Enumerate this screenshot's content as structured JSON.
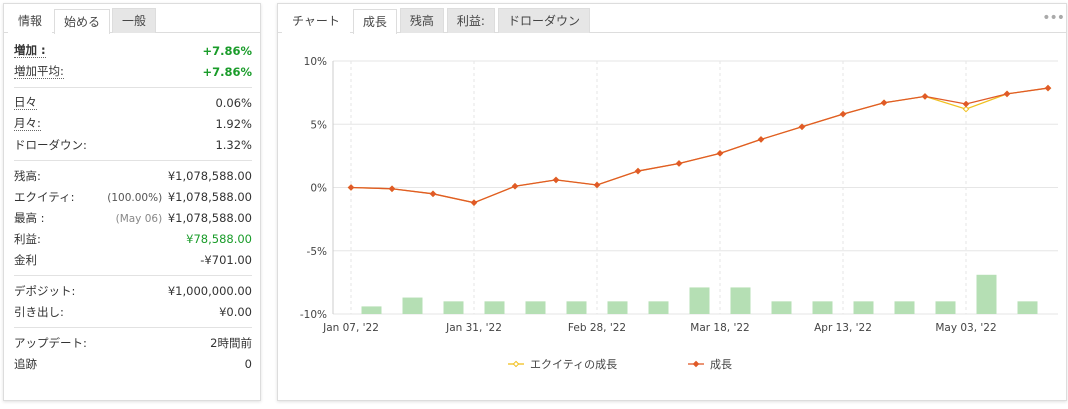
{
  "left": {
    "tabs": [
      {
        "label": "情報"
      },
      {
        "label": "始める"
      },
      {
        "label": "一般"
      }
    ],
    "rows": {
      "gain": {
        "label": "増加 :",
        "value": "+7.86%"
      },
      "abs_gain": {
        "label": "増加平均:",
        "value": "+7.86%"
      },
      "daily": {
        "label": "日々",
        "value": "0.06%"
      },
      "monthly": {
        "label": "月々:",
        "value": "1.92%"
      },
      "drawdown": {
        "label": "ドローダウン:",
        "value": "1.32%"
      },
      "balance": {
        "label": "残高:",
        "value": "¥1,078,588.00"
      },
      "equity": {
        "label": "エクイティ:",
        "pct": "(100.00%)",
        "value": "¥1,078,588.00"
      },
      "highest": {
        "label": "最高 :",
        "date": "(May 06)",
        "value": "¥1,078,588.00"
      },
      "profit": {
        "label": "利益:",
        "value": "¥78,588.00"
      },
      "interest": {
        "label": "金利",
        "value": "-¥701.00"
      },
      "deposits": {
        "label": "デポジット:",
        "value": "¥1,000,000.00"
      },
      "withdrawals": {
        "label": "引き出し:",
        "value": "¥0.00"
      },
      "updated": {
        "label": "アップデート:",
        "value": "2時間前"
      },
      "tracking": {
        "label": "追跡",
        "value": "0"
      }
    }
  },
  "right": {
    "tabs": [
      {
        "label": "チャート"
      },
      {
        "label": "成長"
      },
      {
        "label": "残高"
      },
      {
        "label": "利益:"
      },
      {
        "label": "ドローダウン"
      }
    ],
    "more_icon": "more-dots-icon"
  },
  "chart_data": {
    "type": "line",
    "yticks": [
      "10%",
      "5%",
      "0%",
      "-5%",
      "-10%"
    ],
    "ylim": [
      -10,
      10
    ],
    "xticks": [
      "Jan 07, '22",
      "Jan 31, '22",
      "Feb 28, '22",
      "Mar 18, '22",
      "Apr 13, '22",
      "May 03, '22"
    ],
    "grid": true,
    "legend_position": "bottom",
    "series": [
      {
        "name": "エクイティの成長",
        "color": "#f0c020",
        "values": [
          0.0,
          -0.1,
          -0.5,
          -1.2,
          0.1,
          0.6,
          0.2,
          1.3,
          1.9,
          2.7,
          3.8,
          4.8,
          5.8,
          6.7,
          7.2,
          6.2,
          7.4,
          7.86
        ]
      },
      {
        "name": "成長",
        "color": "#e05a28",
        "values": [
          0.0,
          -0.1,
          -0.5,
          -1.2,
          0.1,
          0.6,
          0.2,
          1.3,
          1.9,
          2.7,
          3.8,
          4.8,
          5.8,
          6.7,
          7.2,
          6.6,
          7.4,
          7.86
        ]
      }
    ],
    "bars": {
      "color": "#b5dfb4",
      "values": [
        0.6,
        1.3,
        1.0,
        1.0,
        1.0,
        1.0,
        1.0,
        1.0,
        2.1,
        2.1,
        1.0,
        1.0,
        1.0,
        1.0,
        1.0,
        3.1,
        1.0
      ]
    }
  }
}
